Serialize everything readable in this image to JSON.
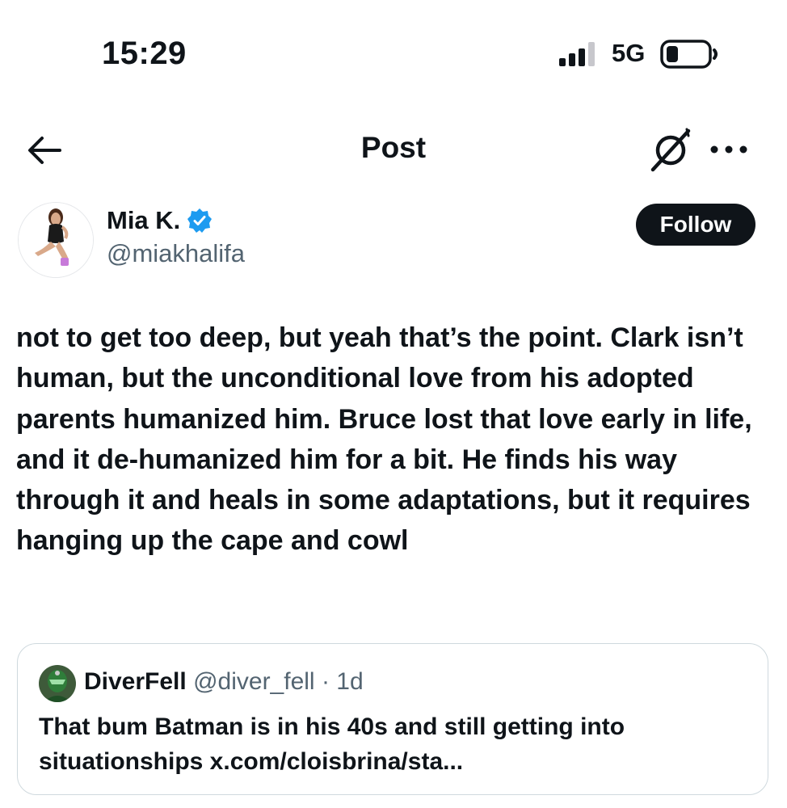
{
  "status_bar": {
    "time": "15:29",
    "network": "5G",
    "icons": [
      "signal-icon",
      "battery-icon"
    ]
  },
  "nav": {
    "title": "Post",
    "icons": [
      "back-arrow-icon",
      "grok-icon",
      "more-icon"
    ]
  },
  "author": {
    "name": "Mia K.",
    "handle": "@miakhalifa",
    "verified": true,
    "follow_label": "Follow"
  },
  "post": {
    "text": "not to get too deep, but yeah that’s the point. Clark isn’t human, but the unconditional love from his adopted parents humanized him. Bruce lost that love early in life, and it de-humanized him for a bit. He finds his way through it and heals in some adaptations, but it requires hanging up the cape and cowl"
  },
  "quote": {
    "name": "DiverFell",
    "handle": "@diver_fell",
    "separator": "·",
    "time": "1d",
    "text": "That bum Batman is in his 40s and still getting into situationships x.com/cloisbrina/sta..."
  },
  "colors": {
    "text": "#0f1419",
    "secondary": "#536471",
    "verified": "#1d9bf0",
    "border": "#cfd9de"
  }
}
